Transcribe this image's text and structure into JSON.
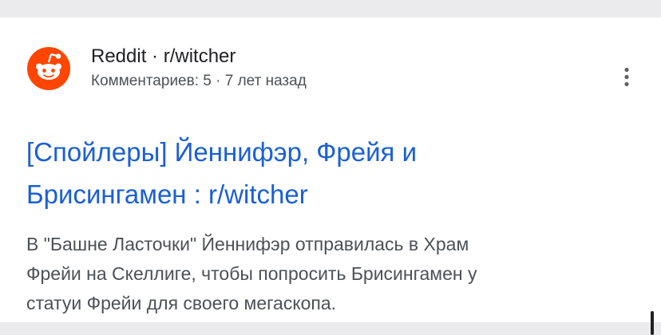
{
  "result": {
    "source_name": "Reddit · r/witcher",
    "source_meta": "Комментариев: 5 · 7 лет назад",
    "title_line1": "[Спойлеры] Йеннифэр, Фрейя и",
    "title_line2": "Брисингамен : r/witcher",
    "snippet_line1": "В \"Башне Ласточки\" Йеннифэр отправилась в Храм",
    "snippet_line2": "Фрейи на Скеллиге, чтобы попросить Брисингамен у",
    "snippet_line3": "статуи Фрейи для своего мегаскопа.",
    "favicon_icon": "reddit-icon",
    "more_icon": "more-vert-icon"
  },
  "colors": {
    "title_link": "#1a5fd6",
    "favicon_bg": "#ff4500",
    "page_bg": "#ebebed",
    "card_bg": "#ffffff"
  }
}
